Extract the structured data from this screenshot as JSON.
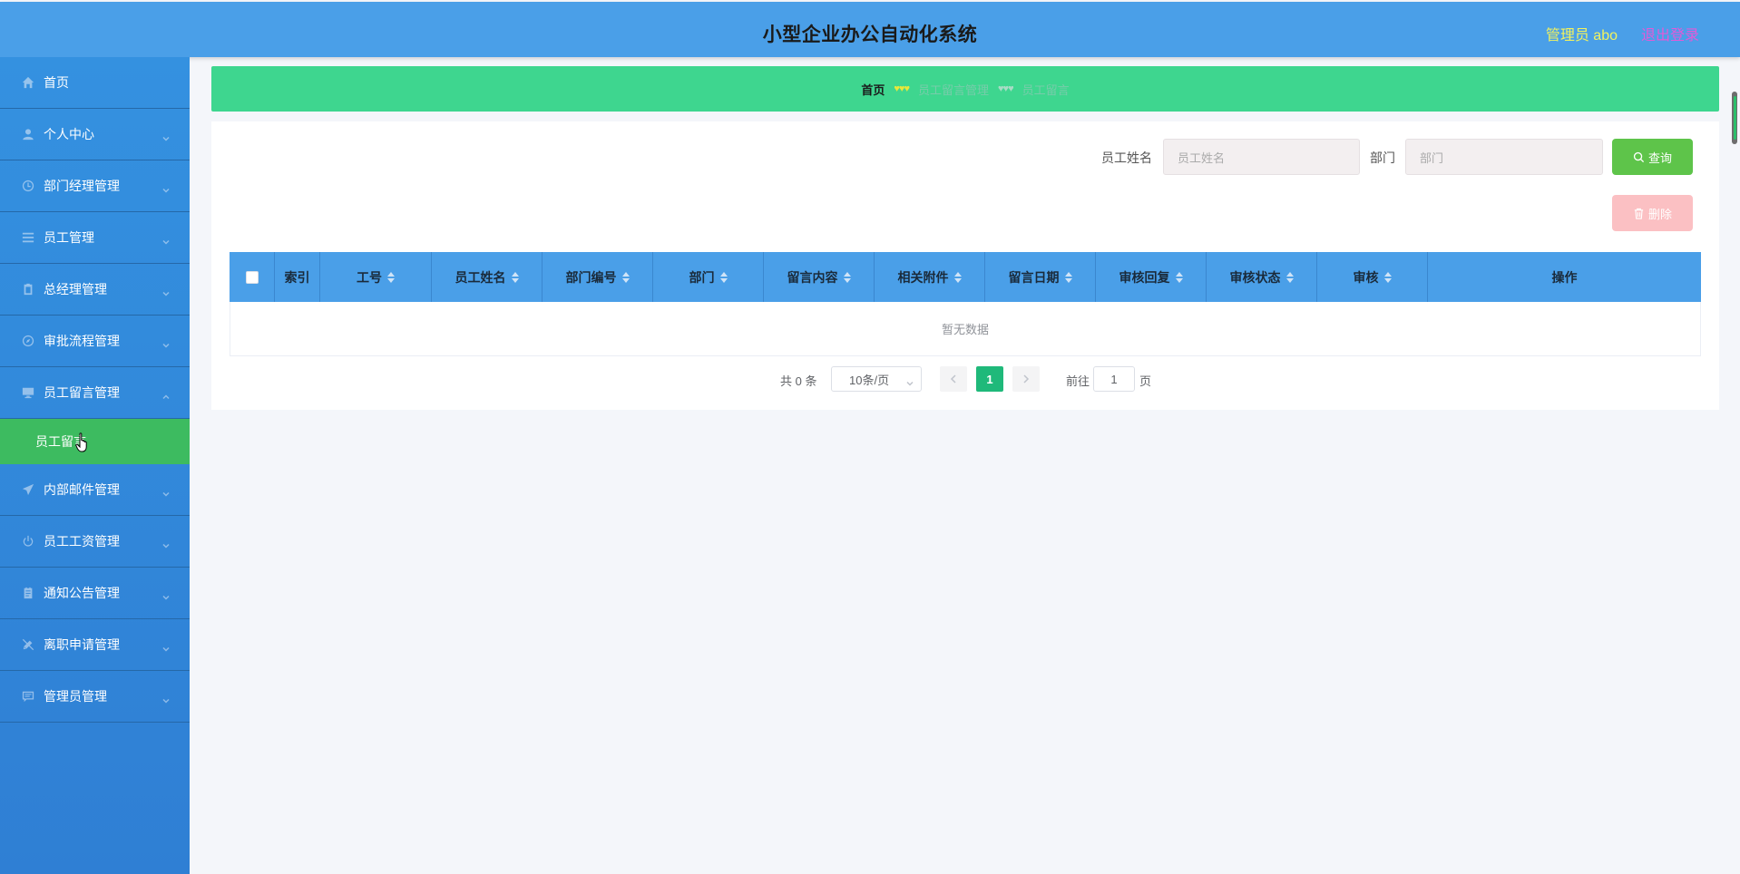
{
  "header": {
    "title": "小型企业办公自动化系统",
    "user": "管理员 abo",
    "logout": "退出登录"
  },
  "sidebar": {
    "items": [
      {
        "label": "首页",
        "icon": "home-icon",
        "has_arrow": false
      },
      {
        "label": "个人中心",
        "icon": "user-icon",
        "has_arrow": true
      },
      {
        "label": "部门经理管理",
        "icon": "clock-icon",
        "has_arrow": true
      },
      {
        "label": "员工管理",
        "icon": "list-icon",
        "has_arrow": true
      },
      {
        "label": "总经理管理",
        "icon": "clipboard-icon",
        "has_arrow": true
      },
      {
        "label": "审批流程管理",
        "icon": "compass-icon",
        "has_arrow": true
      },
      {
        "label": "员工留言管理",
        "icon": "monitor-icon",
        "has_arrow": true,
        "expanded": true
      },
      {
        "label": "内部邮件管理",
        "icon": "send-icon",
        "has_arrow": true
      },
      {
        "label": "员工工资管理",
        "icon": "power-icon",
        "has_arrow": true
      },
      {
        "label": "通知公告管理",
        "icon": "notepad-icon",
        "has_arrow": true
      },
      {
        "label": "离职申请管理",
        "icon": "no-pencil-icon",
        "has_arrow": true
      },
      {
        "label": "管理员管理",
        "icon": "chat-icon",
        "has_arrow": true
      }
    ],
    "submenu": {
      "label": "员工留言"
    }
  },
  "breadcrumb": {
    "home": "首页",
    "sep": "♥♥♥",
    "level1": "员工留言管理",
    "level2": "员工留言"
  },
  "search": {
    "name_label": "员工姓名",
    "name_placeholder": "员工姓名",
    "dept_label": "部门",
    "dept_placeholder": "部门",
    "query_button": "查询",
    "delete_button": "删除"
  },
  "table": {
    "columns": [
      "索引",
      "工号",
      "员工姓名",
      "部门编号",
      "部门",
      "留言内容",
      "相关附件",
      "留言日期",
      "审核回复",
      "审核状态",
      "审核",
      "操作"
    ],
    "empty_text": "暂无数据"
  },
  "pagination": {
    "total": "共 0 条",
    "page_size": "10条/页",
    "current_page": "1",
    "goto_label": "前往",
    "goto_value": "1",
    "page_suffix": "页"
  },
  "colors": {
    "header_bg": "#4a9fe8",
    "sidebar_bg": "#3491e0",
    "active_submenu": "#3dbb60",
    "breadcrumb_bg": "#3ed68f",
    "query_button": "#5ec44a",
    "delete_button": "#fbc0c3",
    "current_page": "#1fb97a",
    "user_text": "#f2f25e",
    "logout_text": "#e35ad8"
  }
}
